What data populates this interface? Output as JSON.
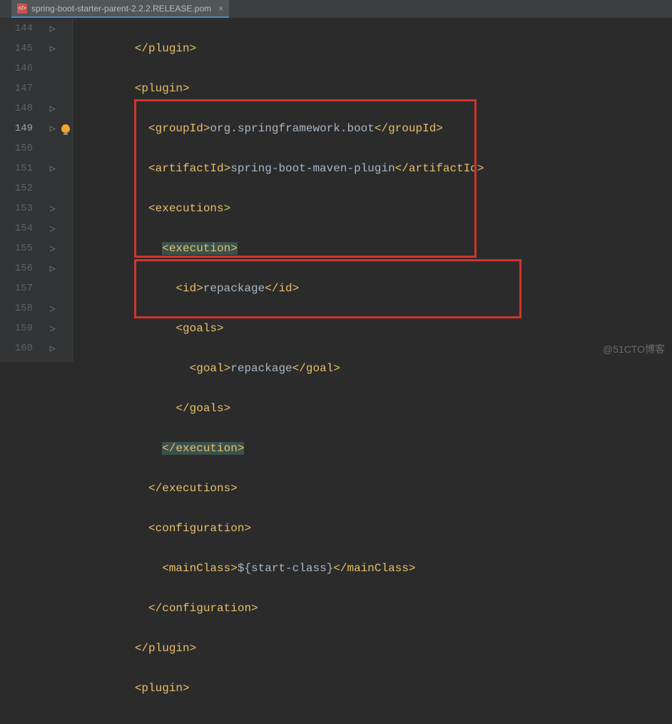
{
  "tab": {
    "icon_label": "</>",
    "filename": "spring-boot-starter-parent-2.2.2.RELEASE.pom",
    "close": "×"
  },
  "gutter": [
    "144",
    "145",
    "146",
    "147",
    "148",
    "149",
    "150",
    "151",
    "152",
    "153",
    "154",
    "155",
    "156",
    "157",
    "158",
    "159",
    "160"
  ],
  "current_line_index": 5,
  "code": {
    "l144": "</plugin>",
    "l145": "<plugin>",
    "l146_open": "<groupId>",
    "l146_text": "org.springframework.boot",
    "l146_close": "</groupId>",
    "l147_open": "<artifactId>",
    "l147_text": "spring-boot-maven-plugin",
    "l147_close": "</artifactId>",
    "l148": "<executions>",
    "l149": "<execution>",
    "l150_open": "<id>",
    "l150_text": "repackage",
    "l150_close": "</id>",
    "l151": "<goals>",
    "l152_open": "<goal>",
    "l152_text": "repackage",
    "l152_close": "</goal>",
    "l153": "</goals>",
    "l154": "</execution>",
    "l155": "</executions>",
    "l156": "<configuration>",
    "l157_open": "<mainClass>",
    "l157_text": "${start-class}",
    "l157_close": "</mainClass>",
    "l158": "</configuration>",
    "l159": "</plugin>",
    "l160": "<plugin>"
  },
  "watermark": "@51CTO博客"
}
